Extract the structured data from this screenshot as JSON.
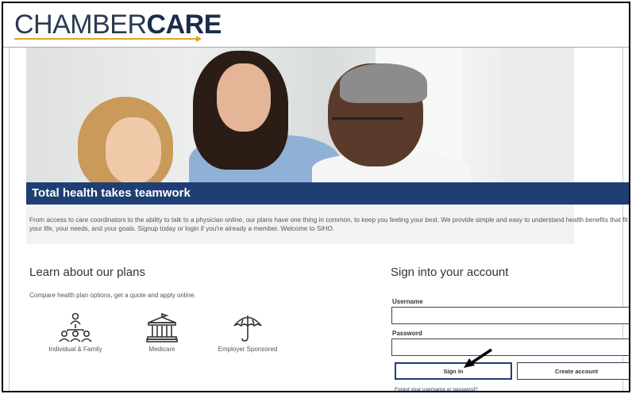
{
  "brand": {
    "light": "CHAMBER",
    "bold": "CARE",
    "accent": "#e0a527",
    "navy": "#1f3e74"
  },
  "hero": {
    "banner_title": "Total health takes teamwork",
    "intro": "From access to care coordinators to the ability to talk to a physician online, our plans have one thing in common, to keep you feeling your best. We provide simple and easy to understand health benefits that fit your life, your needs, and your goals. Signup today or login if you're already a member. Welcome to SIHO."
  },
  "plans": {
    "title": "Learn about our plans",
    "subtitle": "Compare health plan options, get a quote and apply online.",
    "items": [
      {
        "label": "Individual & Family",
        "icon": "people-network-icon"
      },
      {
        "label": "Medicare",
        "icon": "building-columns-icon"
      },
      {
        "label": "Employer Sponsored",
        "icon": "umbrella-icon"
      }
    ]
  },
  "signin": {
    "title": "Sign into your account",
    "username_label": "Username",
    "username_value": "",
    "password_label": "Password",
    "password_value": "",
    "signin_label": "Sign In",
    "create_label": "Create account",
    "forgot_label": "Forgot your username or password?"
  }
}
